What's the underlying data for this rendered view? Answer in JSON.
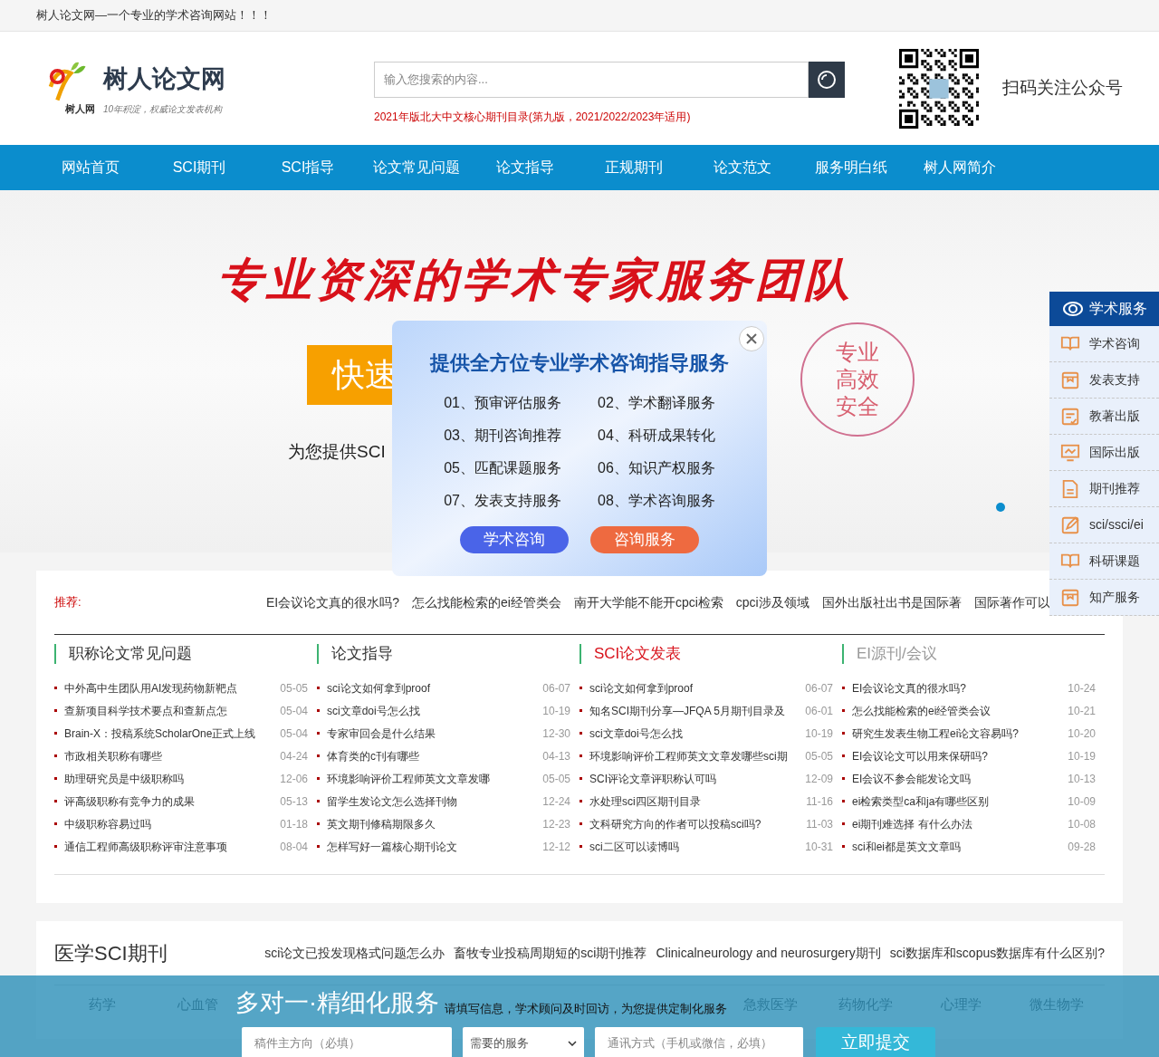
{
  "top_bar": {
    "text": "树人论文网—一个专业的学术咨询网站！！！"
  },
  "logo": {
    "name": "树人论文网",
    "badge": "树人网",
    "slogan": "10年积淀，权威论文发表机构"
  },
  "search": {
    "placeholder": "输入您搜索的内容...",
    "link": "2021年版北大中文核心期刊目录(第九版，2021/2022/2023年适用)"
  },
  "qr": {
    "caption": "扫码关注公众号"
  },
  "nav": [
    "网站首页",
    "SCI期刊",
    "SCI指导",
    "论文常见问题",
    "论文指导",
    "正规期刊",
    "论文范文",
    "服务明白纸",
    "树人网简介"
  ],
  "banner": {
    "headline": "专业资深的学术专家服务团队",
    "button": "快速",
    "subtitle": "为您提供SCI",
    "badge": [
      "专业",
      "高效",
      "安全"
    ]
  },
  "popup": {
    "title": "提供全方位专业学术咨询指导服务",
    "services": [
      "01、预审评估服务",
      "02、学术翻译服务",
      "03、期刊咨询推荐",
      "04、科研成果转化",
      "05、匹配课题服务",
      "06、知识产权服务",
      "07、发表支持服务",
      "08、学术咨询服务"
    ],
    "buttons": [
      {
        "label": "学术咨询",
        "kind": "primary"
      },
      {
        "label": "咨询服务",
        "kind": "secondary"
      }
    ]
  },
  "recommend": {
    "label": "推荐:",
    "links": [
      "EI会议论文真的很水吗?",
      "怎么找能检索的ei经管类会",
      "南开大学能不能开cpci检索",
      "cpci涉及领域",
      "国外出版社出书是国际著",
      "国际著作可以"
    ]
  },
  "columns": [
    {
      "title": "职称论文常见问题",
      "kind": "normal",
      "items": [
        {
          "title": "中外高中生团队用AI发现药物新靶点",
          "date": "05-05"
        },
        {
          "title": "查新项目科学技术要点和查新点怎",
          "date": "05-04"
        },
        {
          "title": "Brain-X：投稿系统ScholarOne正式上线",
          "date": "05-04"
        },
        {
          "title": "市政相关职称有哪些",
          "date": "04-24"
        },
        {
          "title": "助理研究员是中级职称吗",
          "date": "12-06"
        },
        {
          "title": "评高级职称有竞争力的成果",
          "date": "05-13"
        },
        {
          "title": "中级职称容易过吗",
          "date": "01-18"
        },
        {
          "title": "通信工程师高级职称评审注意事项",
          "date": "08-04"
        }
      ]
    },
    {
      "title": "论文指导",
      "kind": "normal",
      "items": [
        {
          "title": "sci论文如何拿到proof",
          "date": "06-07"
        },
        {
          "title": "sci文章doi号怎么找",
          "date": "10-19"
        },
        {
          "title": "专家审回会是什么结果",
          "date": "12-30"
        },
        {
          "title": "体育类的c刊有哪些",
          "date": "04-13"
        },
        {
          "title": "环境影响评价工程师英文文章发哪",
          "date": "05-05"
        },
        {
          "title": "留学生发论文怎么选择刊物",
          "date": "12-24"
        },
        {
          "title": "英文期刊修稿期限多久",
          "date": "12-23"
        },
        {
          "title": "怎样写好一篇核心期刊论文",
          "date": "12-12"
        }
      ]
    },
    {
      "title": "SCI论文发表",
      "kind": "highlight",
      "items": [
        {
          "title": "sci论文如何拿到proof",
          "date": "06-07"
        },
        {
          "title": "知名SCI期刊分享—JFQA 5月期刊目录及",
          "date": "06-01"
        },
        {
          "title": "sci文章doi号怎么找",
          "date": "10-19"
        },
        {
          "title": "环境影响评价工程师英文文章发哪些sci期",
          "date": "05-05"
        },
        {
          "title": "SCI评论文章评职称认可吗",
          "date": "12-09"
        },
        {
          "title": "水处理sci四区期刊目录",
          "date": "11-16"
        },
        {
          "title": "文科研究方向的作者可以投稿sci吗?",
          "date": "11-03"
        },
        {
          "title": "sci二区可以读博吗",
          "date": "10-31"
        }
      ]
    },
    {
      "title": "EI源刊/会议",
      "kind": "muted",
      "items": [
        {
          "title": "EI会议论文真的很水吗?",
          "date": "10-24"
        },
        {
          "title": "怎么找能检索的ei经管类会议",
          "date": "10-21"
        },
        {
          "title": "研究生发表生物工程ei论文容易吗?",
          "date": "10-20"
        },
        {
          "title": "EI会议论文可以用来保研吗?",
          "date": "10-19"
        },
        {
          "title": "EI会议不参会能发论文吗",
          "date": "10-13"
        },
        {
          "title": "ei检索类型ca和ja有哪些区别",
          "date": "10-09"
        },
        {
          "title": "ei期刊难选择 有什么办法",
          "date": "10-08"
        },
        {
          "title": "sci和ei都是英文文章吗",
          "date": "09-28"
        }
      ]
    }
  ],
  "sidebar": {
    "title": "学术服务",
    "items": [
      "学术咨询",
      "发表支持",
      "教著出版",
      "国际出版",
      "期刊推荐",
      "sci/ssci/ei",
      "科研课题",
      "知产服务"
    ]
  },
  "medical": {
    "title": "医学SCI期刊",
    "links": [
      "sci论文已投发现格式问题怎么办",
      "畜牧专业投稿周期短的sci期刊推荐",
      "Clinicalneurology and neurosurgery期刊",
      "sci数据库和scopus数据库有什么区别?"
    ],
    "tabs": [
      "药学",
      "心血管",
      "急救医学",
      "药物化学",
      "心理学",
      "微生物学"
    ]
  },
  "form": {
    "title": "多对一·精细化服务",
    "note": "请填写信息，学术顾问及时回访，为您提供定制化服务",
    "direction_placeholder": "稿件主方向（必填）",
    "service_value": "需要的服务",
    "contact_placeholder": "通讯方式（手机或微信，必填）",
    "submit": "立即提交"
  }
}
